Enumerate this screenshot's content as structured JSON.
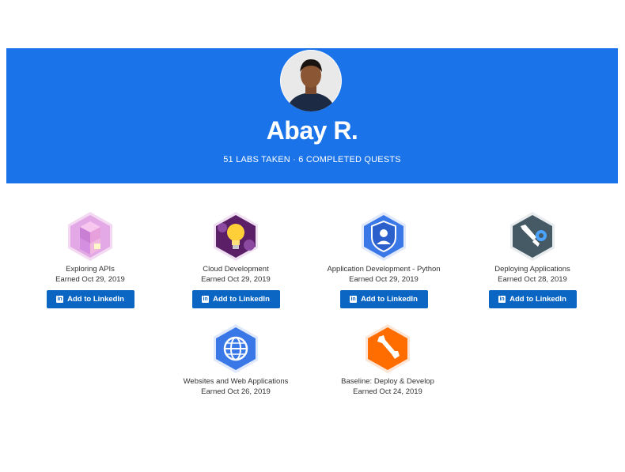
{
  "profile": {
    "name": "Abay R.",
    "stats": "51 LABS TAKEN · 6 COMPLETED QUESTS"
  },
  "badges": [
    {
      "title": "Exploring APIs",
      "earned": "Earned Oct 29, 2019",
      "button": "Add to LinkedIn",
      "icon": "cubes-badge-icon"
    },
    {
      "title": "Cloud Development",
      "earned": "Earned Oct 29, 2019",
      "button": "Add to LinkedIn",
      "icon": "lightbulb-badge-icon"
    },
    {
      "title": "Application Development - Python",
      "earned": "Earned Oct 29, 2019",
      "button": "Add to LinkedIn",
      "icon": "user-shield-badge-icon"
    },
    {
      "title": "Deploying Applications",
      "earned": "Earned Oct 28, 2019",
      "button": "Add to LinkedIn",
      "icon": "wrench-gear-badge-icon"
    },
    {
      "title": "Websites and Web Applications",
      "earned": "Earned Oct 26, 2019",
      "button": "",
      "icon": "globe-badge-icon"
    },
    {
      "title": "Baseline: Deploy & Develop",
      "earned": "Earned Oct 24, 2019",
      "button": "",
      "icon": "wrench-badge-icon"
    }
  ],
  "colors": {
    "hero": "#1a73e8",
    "linkedin": "#0a66c2"
  }
}
